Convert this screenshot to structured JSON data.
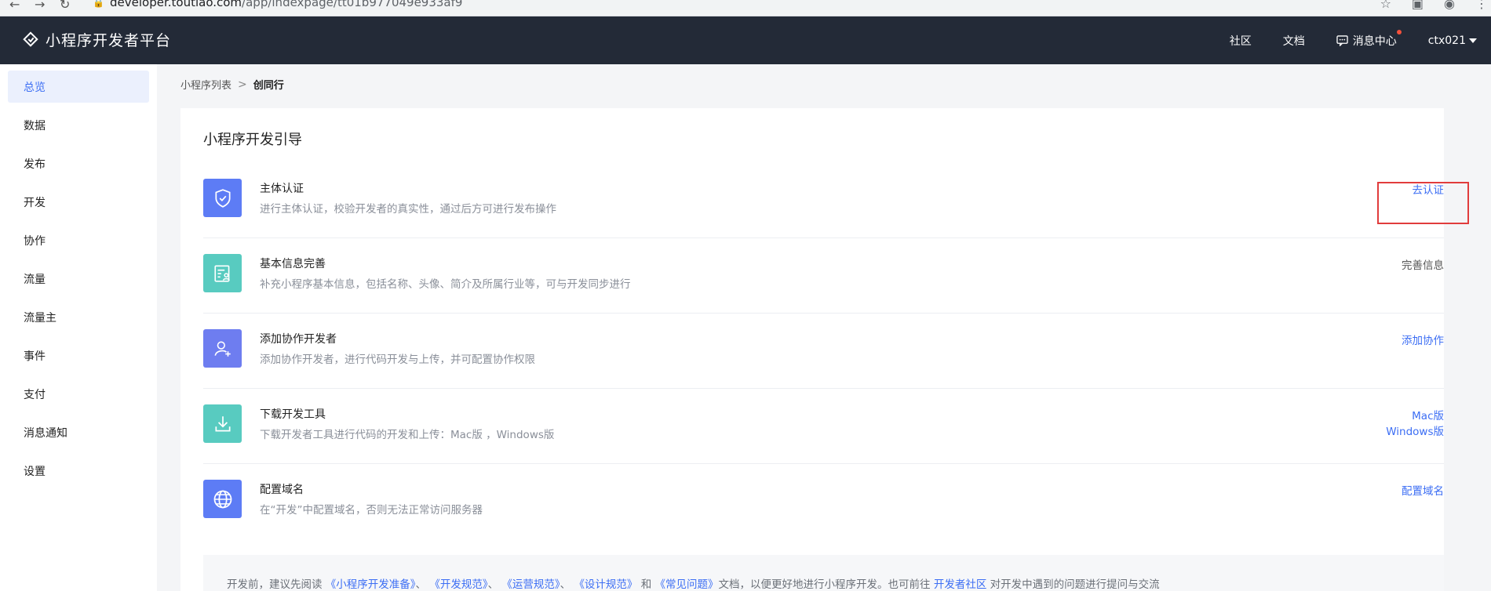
{
  "browser": {
    "url_host": "developer.toutiao.com",
    "url_path": "/app/indexpage/tt01b977049e933af9"
  },
  "topnav": {
    "brand": "小程序开发者平台",
    "links": {
      "community": "社区",
      "docs": "文档",
      "messages": "消息中心",
      "user": "ctx021"
    }
  },
  "sidebar": {
    "items": [
      {
        "label": "总览",
        "active": true
      },
      {
        "label": "数据"
      },
      {
        "label": "发布"
      },
      {
        "label": "开发"
      },
      {
        "label": "协作"
      },
      {
        "label": "流量"
      },
      {
        "label": "流量主"
      },
      {
        "label": "事件"
      },
      {
        "label": "支付"
      },
      {
        "label": "消息通知"
      },
      {
        "label": "设置"
      }
    ]
  },
  "breadcrumb": {
    "root": "小程序列表",
    "separator": ">",
    "current": "创同行"
  },
  "guide": {
    "title": "小程序开发引导",
    "steps": [
      {
        "icon": "shield-check-icon",
        "title": "主体认证",
        "desc": "进行主体认证，校验开发者的真实性，通过后方可进行发布操作",
        "action": "去认证"
      },
      {
        "icon": "profile-card-icon",
        "title": "基本信息完善",
        "desc": "补充小程序基本信息，包括名称、头像、简介及所属行业等，可与开发同步进行",
        "action": "完善信息"
      },
      {
        "icon": "add-user-icon",
        "title": "添加协作开发者",
        "desc": "添加协作开发者，进行代码开发与上传，并可配置协作权限",
        "action": "添加协作"
      },
      {
        "icon": "download-icon",
        "title": "下载开发工具",
        "desc": "下载开发者工具进行代码的开发和上传：Mac版 ，Windows版",
        "action": "Mac版",
        "action2": "Windows版"
      },
      {
        "icon": "globe-icon",
        "title": "配置域名",
        "desc": "在“开发”中配置域名，否则无法正常访问服务器",
        "action": "配置域名"
      }
    ]
  },
  "tips": {
    "prefix": "开发前，建议先阅读",
    "doc1": "《小程序开发准备》",
    "sep1": "、",
    "doc2": "《开发规范》",
    "sep2": "、",
    "doc3": "《运营规范》",
    "sep3": "、",
    "doc4": "《设计规范》",
    "and": "和",
    "doc5": "《常见问题》",
    "middle": "文档，以便更好地进行小程序开发。也可前往",
    "community": "开发者社区",
    "suffix": "对开发中遇到的问题进行提问与交流"
  },
  "colors": {
    "nav_bg": "#232a37",
    "accent": "#3c6ef4",
    "icon_blue": "#5d7cf5",
    "icon_teal": "#58cbc0",
    "highlight_red": "#e13c3c"
  }
}
